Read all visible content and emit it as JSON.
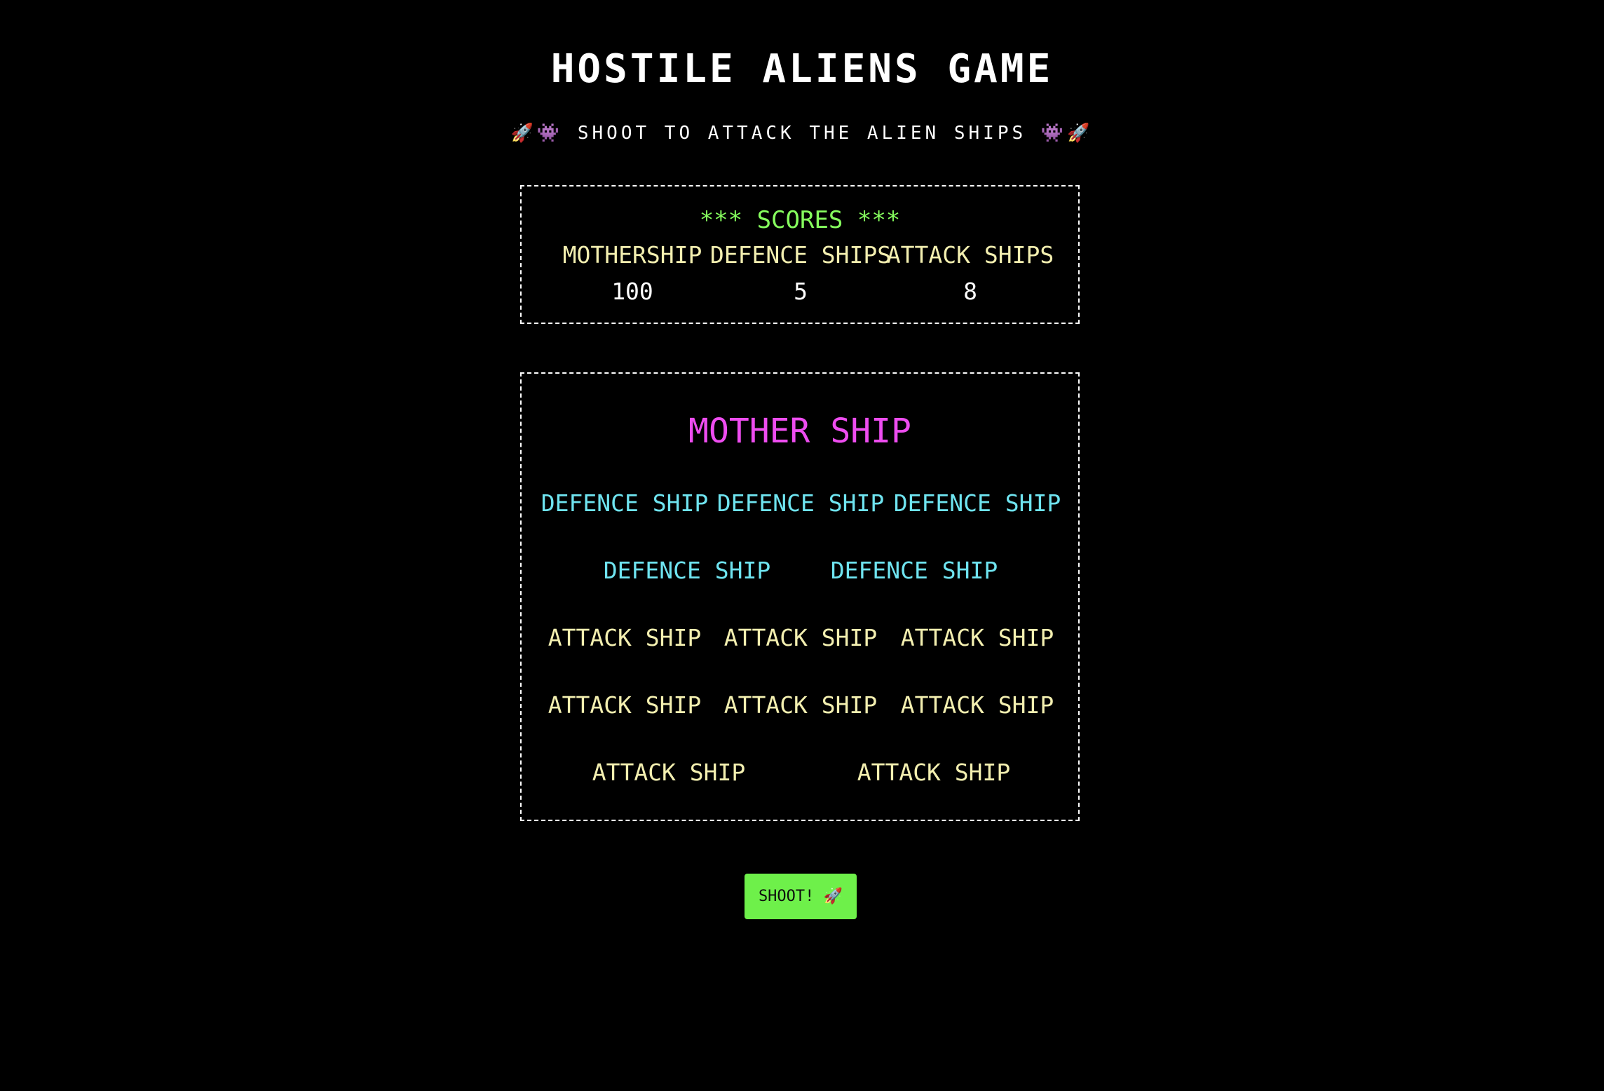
{
  "header": {
    "title": "HOSTILE ALIENS GAME",
    "subtitle": "🚀👾 SHOOT TO ATTACK THE ALIEN SHIPS 👾🚀"
  },
  "scores": {
    "heading": "*** SCORES ***",
    "columns": [
      {
        "label": "MOTHERSHIP",
        "value": "100"
      },
      {
        "label": "DEFENCE SHIPS",
        "value": "5"
      },
      {
        "label": "ATTACK SHIPS",
        "value": "8"
      }
    ]
  },
  "ships": {
    "mother": "MOTHER SHIP",
    "defence_label": "DEFENCE SHIP",
    "attack_label": "ATTACK SHIP"
  },
  "actions": {
    "shoot_label": "SHOOT! 🚀"
  },
  "colors": {
    "background": "#000000",
    "scores_heading": "#86ff5e",
    "mother_ship": "#ee4df0",
    "defence_ship": "#6fe4f0",
    "attack_ship": "#f3efb0",
    "button": "#6ef04a"
  }
}
